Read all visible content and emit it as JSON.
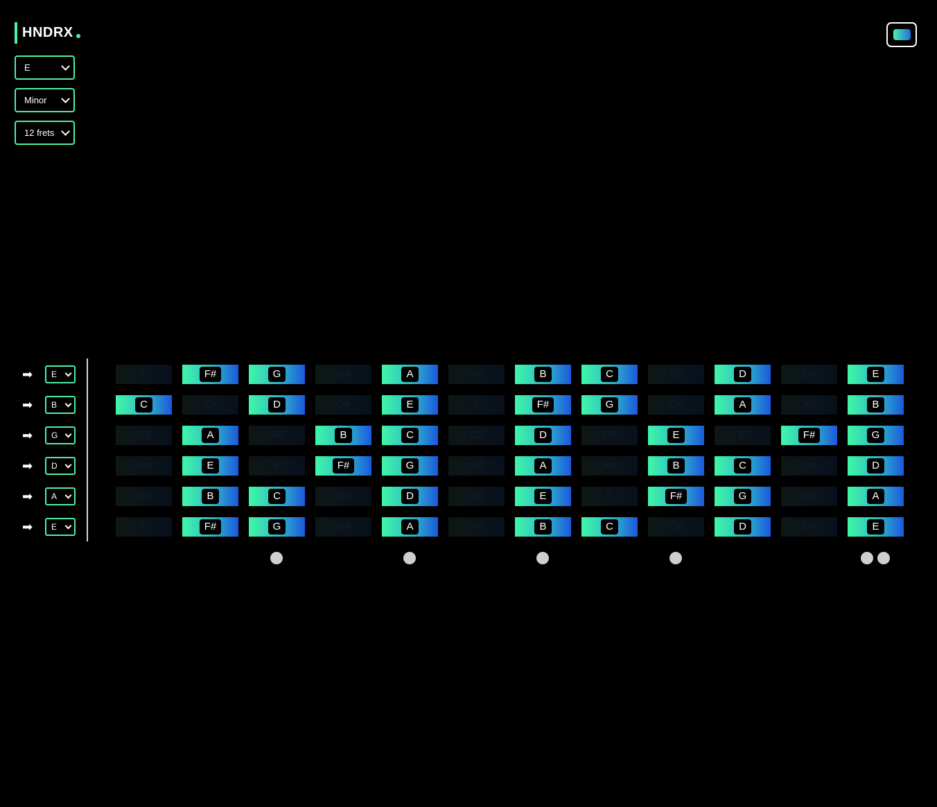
{
  "logo": {
    "text": "HNDRX"
  },
  "controls": {
    "key": "E",
    "scale": "Minor",
    "frets": "12 frets"
  },
  "theme_toggle": {
    "icon": "theme-swatch-icon"
  },
  "colors": {
    "accent": "#4ef0a5",
    "gradient_start": "#3ff8a6",
    "gradient_end": "#1b58dd"
  },
  "strings": [
    {
      "tuning": "E",
      "notes": [
        {
          "n": "F",
          "on": false
        },
        {
          "n": "F#",
          "on": true
        },
        {
          "n": "G",
          "on": true
        },
        {
          "n": "G#",
          "on": false
        },
        {
          "n": "A",
          "on": true
        },
        {
          "n": "A#",
          "on": false
        },
        {
          "n": "B",
          "on": true
        },
        {
          "n": "C",
          "on": true
        },
        {
          "n": "C#",
          "on": false
        },
        {
          "n": "D",
          "on": true
        },
        {
          "n": "D#",
          "on": false
        },
        {
          "n": "E",
          "on": true
        }
      ]
    },
    {
      "tuning": "B",
      "notes": [
        {
          "n": "C",
          "on": true
        },
        {
          "n": "C#",
          "on": false
        },
        {
          "n": "D",
          "on": true
        },
        {
          "n": "D#",
          "on": false
        },
        {
          "n": "E",
          "on": true
        },
        {
          "n": "F",
          "on": false
        },
        {
          "n": "F#",
          "on": true
        },
        {
          "n": "G",
          "on": true
        },
        {
          "n": "G#",
          "on": false
        },
        {
          "n": "A",
          "on": true
        },
        {
          "n": "A#",
          "on": false
        },
        {
          "n": "B",
          "on": true
        }
      ]
    },
    {
      "tuning": "G",
      "notes": [
        {
          "n": "G#",
          "on": false
        },
        {
          "n": "A",
          "on": true
        },
        {
          "n": "A#",
          "on": false
        },
        {
          "n": "B",
          "on": true
        },
        {
          "n": "C",
          "on": true
        },
        {
          "n": "C#",
          "on": false
        },
        {
          "n": "D",
          "on": true
        },
        {
          "n": "D#",
          "on": false
        },
        {
          "n": "E",
          "on": true
        },
        {
          "n": "F",
          "on": false
        },
        {
          "n": "F#",
          "on": true
        },
        {
          "n": "G",
          "on": true
        }
      ]
    },
    {
      "tuning": "D",
      "notes": [
        {
          "n": "D#",
          "on": false
        },
        {
          "n": "E",
          "on": true
        },
        {
          "n": "F",
          "on": false
        },
        {
          "n": "F#",
          "on": true
        },
        {
          "n": "G",
          "on": true
        },
        {
          "n": "G#",
          "on": false
        },
        {
          "n": "A",
          "on": true
        },
        {
          "n": "A#",
          "on": false
        },
        {
          "n": "B",
          "on": true
        },
        {
          "n": "C",
          "on": true
        },
        {
          "n": "C#",
          "on": false
        },
        {
          "n": "D",
          "on": true
        }
      ]
    },
    {
      "tuning": "A",
      "notes": [
        {
          "n": "A#",
          "on": false
        },
        {
          "n": "B",
          "on": true
        },
        {
          "n": "C",
          "on": true
        },
        {
          "n": "C#",
          "on": false
        },
        {
          "n": "D",
          "on": true
        },
        {
          "n": "D#",
          "on": false
        },
        {
          "n": "E",
          "on": true
        },
        {
          "n": "F",
          "on": false
        },
        {
          "n": "F#",
          "on": true
        },
        {
          "n": "G",
          "on": true
        },
        {
          "n": "G#",
          "on": false
        },
        {
          "n": "A",
          "on": true
        }
      ]
    },
    {
      "tuning": "E",
      "notes": [
        {
          "n": "F",
          "on": false
        },
        {
          "n": "F#",
          "on": true
        },
        {
          "n": "G",
          "on": true
        },
        {
          "n": "G#",
          "on": false
        },
        {
          "n": "A",
          "on": true
        },
        {
          "n": "A#",
          "on": false
        },
        {
          "n": "B",
          "on": true
        },
        {
          "n": "C",
          "on": true
        },
        {
          "n": "C#",
          "on": false
        },
        {
          "n": "D",
          "on": true
        },
        {
          "n": "D#",
          "on": false
        },
        {
          "n": "E",
          "on": true
        }
      ]
    }
  ],
  "fret_markers": [
    {
      "fret": 3,
      "dots": 1
    },
    {
      "fret": 5,
      "dots": 1
    },
    {
      "fret": 7,
      "dots": 1
    },
    {
      "fret": 9,
      "dots": 1
    },
    {
      "fret": 12,
      "dots": 2
    }
  ]
}
